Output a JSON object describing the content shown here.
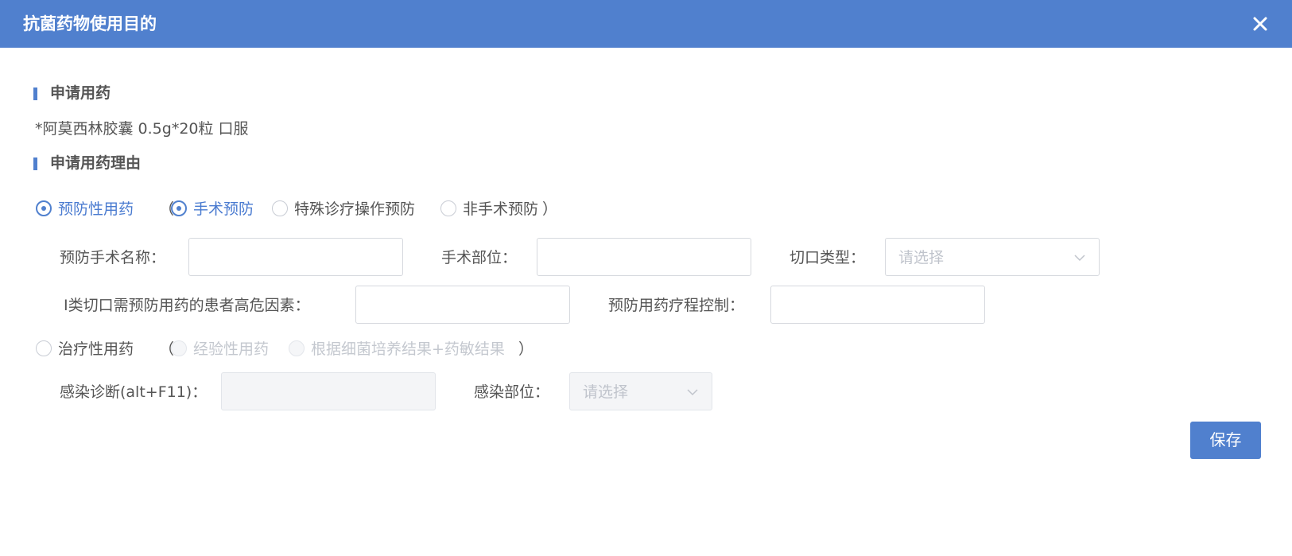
{
  "dialog": {
    "title": "抗菌药物使用目的",
    "close_icon": "close-icon"
  },
  "section_apply": {
    "title": "申请用药",
    "drug_text": "*阿莫西林胶囊 0.5g*20粒 口服"
  },
  "section_reason": {
    "title": "申请用药理由"
  },
  "prophylactic": {
    "label": "预防性用药",
    "selected": true,
    "paren_open": "（",
    "paren_close": "）",
    "options": [
      {
        "label": "手术预防",
        "selected": true
      },
      {
        "label": "特殊诊疗操作预防",
        "selected": false
      },
      {
        "label": "非手术预防",
        "selected": false
      }
    ],
    "fields": {
      "surgery_name_label": "预防手术名称：",
      "surgery_name_value": "",
      "surgery_site_label": "手术部位：",
      "surgery_site_value": "",
      "incision_type_label": "切口类型：",
      "incision_type_placeholder": "请选择",
      "risk_factor_label": "Ⅰ类切口需预防用药的患者高危因素：",
      "risk_factor_value": "",
      "course_control_label": "预防用药疗程控制：",
      "course_control_value": ""
    }
  },
  "therapeutic": {
    "label": "治疗性用药",
    "selected": false,
    "paren_open": "（",
    "paren_close": "）",
    "options": [
      {
        "label": "经验性用药",
        "selected": false,
        "disabled": true
      },
      {
        "label": "根据细菌培养结果+药敏结果",
        "selected": false,
        "disabled": true
      }
    ],
    "fields": {
      "diagnosis_label": "感染诊断(alt+F11)：",
      "diagnosis_value": "",
      "infection_site_label": "感染部位：",
      "infection_site_placeholder": "请选择"
    }
  },
  "footer": {
    "save_label": "保存"
  },
  "colors": {
    "primary": "#5080ce",
    "text": "#555555",
    "active_text": "#4a7bd0",
    "disabled_text": "#c4c8cf",
    "border": "#d6d9de"
  }
}
